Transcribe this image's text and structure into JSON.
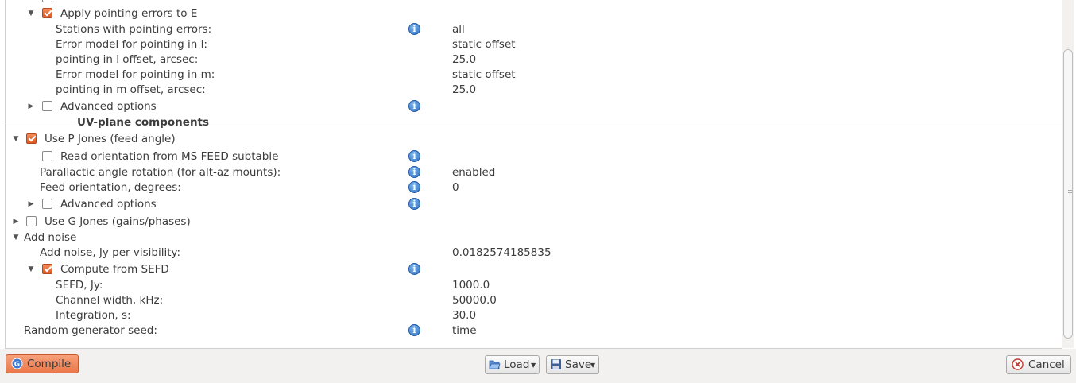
{
  "tree": {
    "apply_pointing": {
      "label": "Apply pointing errors to E",
      "checked": true
    },
    "stations": {
      "label": "Stations with pointing errors:",
      "value": "all"
    },
    "err_model_l": {
      "label": "Error model for pointing in l:",
      "value": "static offset"
    },
    "offset_l": {
      "label": "pointing in l offset, arcsec:",
      "value": "25.0"
    },
    "err_model_m": {
      "label": "Error model for pointing in m:",
      "value": "static offset"
    },
    "offset_m": {
      "label": "pointing in m offset, arcsec:",
      "value": "25.0"
    },
    "adv_options_1": {
      "label": "Advanced options",
      "checked": false
    },
    "section_uv": {
      "label": "UV-plane components"
    },
    "use_p_jones": {
      "label": "Use P Jones (feed angle)",
      "checked": true
    },
    "read_orientation": {
      "label": "Read orientation from MS FEED subtable",
      "checked": false
    },
    "parallactic": {
      "label": "Parallactic angle rotation (for alt-az mounts):",
      "value": "enabled"
    },
    "feed_orientation": {
      "label": "Feed orientation, degrees:",
      "value": "0"
    },
    "adv_options_2": {
      "label": "Advanced options",
      "checked": false
    },
    "use_g_jones": {
      "label": "Use G Jones (gains/phases)",
      "checked": false
    },
    "add_noise": {
      "label": "Add noise"
    },
    "noise_per_vis": {
      "label": "Add noise, Jy per visibility:",
      "value": "0.0182574185835"
    },
    "compute_sefd": {
      "label": "Compute from SEFD",
      "checked": true
    },
    "sefd": {
      "label": "SEFD, Jy:",
      "value": "1000.0"
    },
    "channel_width": {
      "label": "Channel width, kHz:",
      "value": "50000.0"
    },
    "integration": {
      "label": "Integration, s:",
      "value": "30.0"
    },
    "random_seed": {
      "label": "Random generator seed:",
      "value": "time"
    }
  },
  "buttons": {
    "compile": "Compile",
    "load": "Load",
    "save": "Save",
    "cancel": "Cancel"
  },
  "icons": {
    "info": "info-icon",
    "expand": "triangle-right",
    "collapse": "triangle-down"
  },
  "colors": {
    "checkbox_checked": "#e0571f",
    "info_icon": "#2a6cc0",
    "compile_button": "#e9784a"
  }
}
